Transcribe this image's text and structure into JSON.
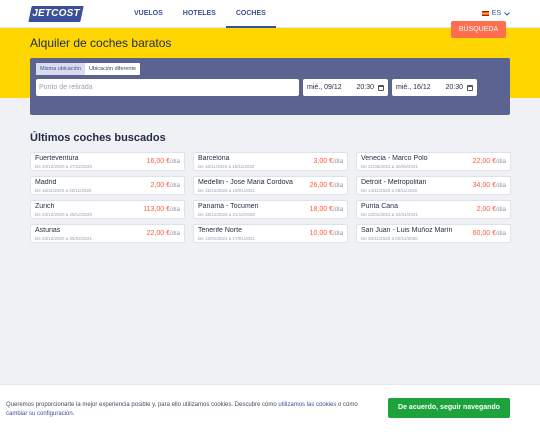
{
  "header": {
    "logo": "JETCOST",
    "nav": [
      {
        "label": "VUELOS"
      },
      {
        "label": "HOTELES"
      },
      {
        "label": "COCHES"
      }
    ],
    "language": "ES"
  },
  "hero": {
    "title": "Alquiler de coches baratos"
  },
  "search": {
    "tabs": [
      {
        "label": "Misma ubicación",
        "selected": true
      },
      {
        "label": "Ubicación diferente",
        "selected": false
      }
    ],
    "pickup_placeholder": "Punto de retirada",
    "pickup_date": "mié., 09/12",
    "pickup_time": "20:30",
    "return_date": "mié., 16/12",
    "return_time": "20:30",
    "button_label": "BÚSQUEDA"
  },
  "recent": {
    "title": "Últimos coches buscados",
    "price_unit": "/día",
    "items": [
      {
        "city": "Fuerteventura",
        "dates": "De 20/12/2020 a 27/12/2020",
        "price": "16,00 €"
      },
      {
        "city": "Barcelona",
        "dates": "De 16/11/2020 a 18/11/2020",
        "price": "3,00 €"
      },
      {
        "city": "Venecia - Marco Polo",
        "dates": "De 21/06/2021 a 30/06/2021",
        "price": "22,00 €"
      },
      {
        "city": "Madrid",
        "dates": "De 16/11/2020 a 20/11/2020",
        "price": "2,00 €"
      },
      {
        "city": "Medellin - Jose Maria Cordova",
        "dates": "De 15/12/2020 a 19/01/2021",
        "price": "26,00 €"
      },
      {
        "city": "Detroit - Metropolitan",
        "dates": "De 14/11/2020 a 28/11/2020",
        "price": "34,00 €"
      },
      {
        "city": "Zurich",
        "dates": "De 23/12/2020 a 25/12/2020",
        "price": "113,00 €"
      },
      {
        "city": "Panamá - Tocumen",
        "dates": "De 18/12/2020 a 21/12/2020",
        "price": "18,00 €"
      },
      {
        "city": "Punta Cana",
        "dates": "De 22/01/2021 a 23/01/2021",
        "price": "2,00 €"
      },
      {
        "city": "Asturias",
        "dates": "De 23/12/2020 a 05/02/2021",
        "price": "22,00 €"
      },
      {
        "city": "Tenerife Norte",
        "dates": "De 12/01/2021 a 17/01/2021",
        "price": "10,00 €"
      },
      {
        "city": "San Juan - Luis Muñoz Marín",
        "dates": "De 20/11/2020 a 02/12/2020",
        "price": "60,00 €"
      }
    ]
  },
  "cookie": {
    "text_before": "Queremos proporcionarte la mejor experiencia posible y, para ello utilizamos cookies. Descubre cómo ",
    "link1": "utilizamos las cookies",
    "text_middle": " o cómo ",
    "link2": "cambiar su configuración",
    "text_after": ".",
    "button_label": "De acuerdo, seguir navegando"
  },
  "colors": {
    "brand": "#3c4f9a",
    "hero_yellow": "#ffd600",
    "search_button": "#ff6e4e",
    "price": "#ff5a36",
    "accept_button": "#1da33b"
  }
}
